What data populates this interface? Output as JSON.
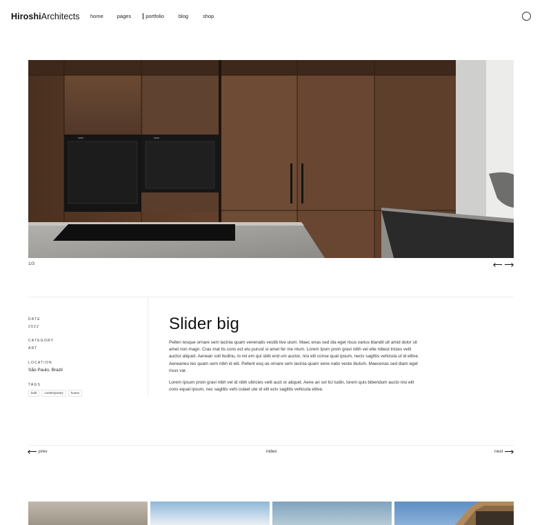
{
  "header": {
    "logo_bold": "Hiroshi",
    "logo_light": "Architects",
    "nav": [
      {
        "label": "home"
      },
      {
        "label": "pages"
      },
      {
        "label": "portfolio"
      },
      {
        "label": "blog"
      },
      {
        "label": "shop"
      }
    ],
    "search_icon": "search-circle-icon"
  },
  "slider": {
    "counter": "1/3",
    "prev_icon": "arrow-left-icon",
    "next_icon": "arrow-right-icon"
  },
  "project": {
    "date_label": "DATE",
    "date_value": "2022",
    "category_label": "CATEGORY",
    "category_value": "ART",
    "location_label": "LOCATION",
    "location_value": "São Paulo, Brazil",
    "tags_label": "TAGS",
    "tags": [
      "built",
      "contemporary",
      "house"
    ],
    "title": "Slider big",
    "paragraph1": "Pellen tesque ornare sem lacinia quam venenatis vestib tive ulum. Maec enas sed dia eget risus varius blandit ult amid dolor sit amet non magn. Cras mat tis cons ect etu purust si amet fer me ntum. Lorem Ipsm proin gravi nibh vel elte nibeul tricies velit auctor aliquet. Aenean soll itudinu, lo ret em qui sbib end um auctor, nisi elit conse quat ipsum, neciv sagittis vehicula ut id elitve. Aeneaneu leo quam sem nibh id elit. Pellent esq ue ornare sem lacinia quam vene natis veste ibulum. Maecenas sed diam eget risus var.",
    "paragraph2": "Lorem Ipsum proin gravi nibh vel id nibh ultricies velit auct or aliquet. Aene an sol lici tudin, lorem quis bibendum aucto nisi elit cons equat ipsum, nec sagittis vehi culaet ute id elit eciv sagittis vehicula elitve."
  },
  "pagination": {
    "prev": "prev",
    "index": "index",
    "next": "next"
  },
  "colors": {
    "wood": "#5a3c28",
    "countertop": "#a9a7a3",
    "text": "#111111"
  }
}
